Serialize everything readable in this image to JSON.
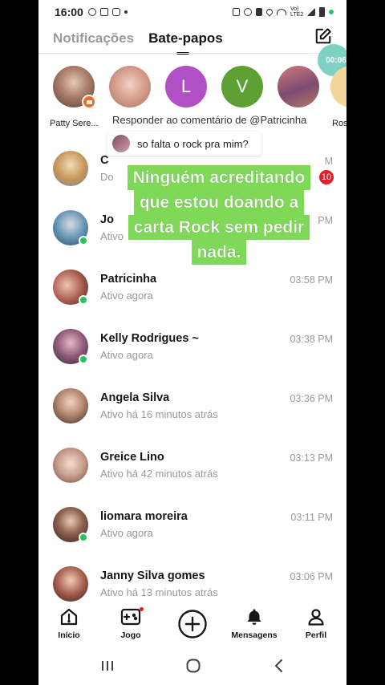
{
  "status_bar": {
    "time": "16:00",
    "network": "Vo) LTE2"
  },
  "header": {
    "tabs": [
      {
        "label": "Notificações",
        "active": false
      },
      {
        "label": "Bate-papos",
        "active": true
      }
    ]
  },
  "screen_timer": "00:06",
  "stories": [
    {
      "name": "Patty Sere...",
      "live": true,
      "color": "#c9a28f"
    },
    {
      "name": "",
      "live": false,
      "color": "#e6b6a8"
    },
    {
      "name": "",
      "letter": "L",
      "color": "#b14fc5"
    },
    {
      "name": "",
      "letter": "V",
      "color": "#5ea033"
    },
    {
      "name": "",
      "live": false,
      "color": "#b56b6b"
    },
    {
      "name": "Ros",
      "live": false,
      "color": "#f2d69a"
    }
  ],
  "reply": {
    "label": "Responder ao comentário de @Patricinha",
    "text": "so falta o rock pra mim?"
  },
  "caption_lines": [
    "Ninguém acreditando",
    "que estou doando a",
    "carta Rock sem pedir",
    "nada."
  ],
  "chats": [
    {
      "name": "C",
      "status": "Do",
      "time": "M",
      "badge": "10",
      "online": false,
      "color": "#c49356"
    },
    {
      "name": "Jo",
      "status": "Ativo",
      "time": "PM",
      "badge": "",
      "online": true,
      "color": "#5f8fb0"
    },
    {
      "name": "Patricinha",
      "status": "Ativo agora",
      "time": "03:58 PM",
      "badge": "",
      "online": true,
      "color": "#a8594a"
    },
    {
      "name": "Kelly Rodrigues ~",
      "status": "Ativo agora",
      "time": "03:38 PM",
      "badge": "",
      "online": true,
      "color": "#5b4a63"
    },
    {
      "name": "Angela Silva",
      "status": "Ativo há 16 minutos atrás",
      "time": "03:36 PM",
      "badge": "",
      "online": false,
      "color": "#8b5e4c"
    },
    {
      "name": "Greice Lino",
      "status": "Ativo há 42 minutos atrás",
      "time": "03:13 PM",
      "badge": "",
      "online": false,
      "color": "#b28b79"
    },
    {
      "name": "liomara moreira",
      "status": "Ativo agora",
      "time": "03:11 PM",
      "badge": "",
      "online": true,
      "color": "#6e4a3e"
    },
    {
      "name": "Janny Silva gomes",
      "status": "Ativo há 13 minutos atrás",
      "time": "03:06 PM",
      "badge": "",
      "online": false,
      "color": "#a65f4e"
    }
  ],
  "bottom_nav": [
    {
      "label": "Início",
      "icon": "home-icon"
    },
    {
      "label": "Jogo",
      "icon": "gamepad-icon"
    },
    {
      "label": "",
      "icon": "plus-circle-icon"
    },
    {
      "label": "Mensagens",
      "icon": "bell-icon"
    },
    {
      "label": "Perfil",
      "icon": "person-icon"
    }
  ],
  "colors": {
    "online": "#23c35e",
    "caption_bg": "#7ed957",
    "badge": "#e11d2a",
    "live": "#f26b21"
  }
}
